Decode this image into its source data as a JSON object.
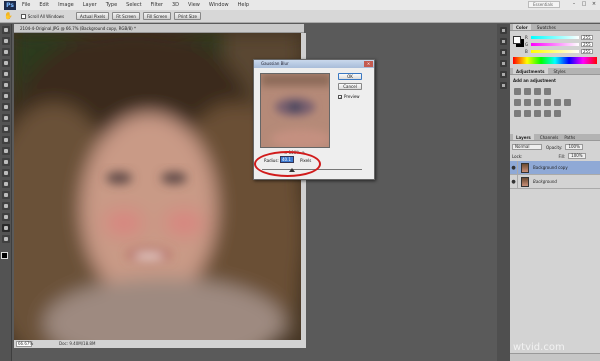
{
  "app": {
    "logo": "Ps",
    "workspace": "Essentials"
  },
  "menu": [
    "File",
    "Edit",
    "Image",
    "Layer",
    "Type",
    "Select",
    "Filter",
    "3D",
    "View",
    "Window",
    "Help"
  ],
  "options_bar": {
    "scroll_all_label": "Scroll All Windows",
    "buttons": [
      "Actual Pixels",
      "Fit Screen",
      "Fill Screen",
      "Print Size"
    ]
  },
  "document": {
    "tab_title": "2104-4-Original.JPG @ 66.7% (Background copy, RGB/8) *",
    "zoom": "66.67%",
    "doc_size": "Doc: 9.40M/18.8M"
  },
  "dialog": {
    "title": "Gaussian Blur",
    "ok_label": "OK",
    "cancel_label": "Cancel",
    "preview_label": "Preview",
    "preview_checked": true,
    "zoom_value": "100%",
    "radius_label": "Radius:",
    "radius_value": "40.1",
    "radius_unit": "Pixels",
    "highlight_color": "#d11b1b"
  },
  "panels": {
    "color": {
      "tabs": [
        "Color",
        "Swatches"
      ],
      "values": [
        "255",
        "255",
        "255"
      ]
    },
    "adjustments": {
      "tabs": [
        "Adjustments",
        "Styles"
      ],
      "title": "Add an adjustment"
    },
    "layers": {
      "tabs": [
        "Layers",
        "Channels",
        "Paths"
      ],
      "kind": "Normal",
      "opacity_label": "Opacity:",
      "opacity_value": "100%",
      "lock_label": "Lock:",
      "fill_label": "Fill:",
      "fill_value": "100%",
      "items": [
        {
          "name": "Background copy",
          "selected": true
        },
        {
          "name": "Background",
          "selected": false
        }
      ]
    }
  },
  "watermark": "wtvid.com"
}
